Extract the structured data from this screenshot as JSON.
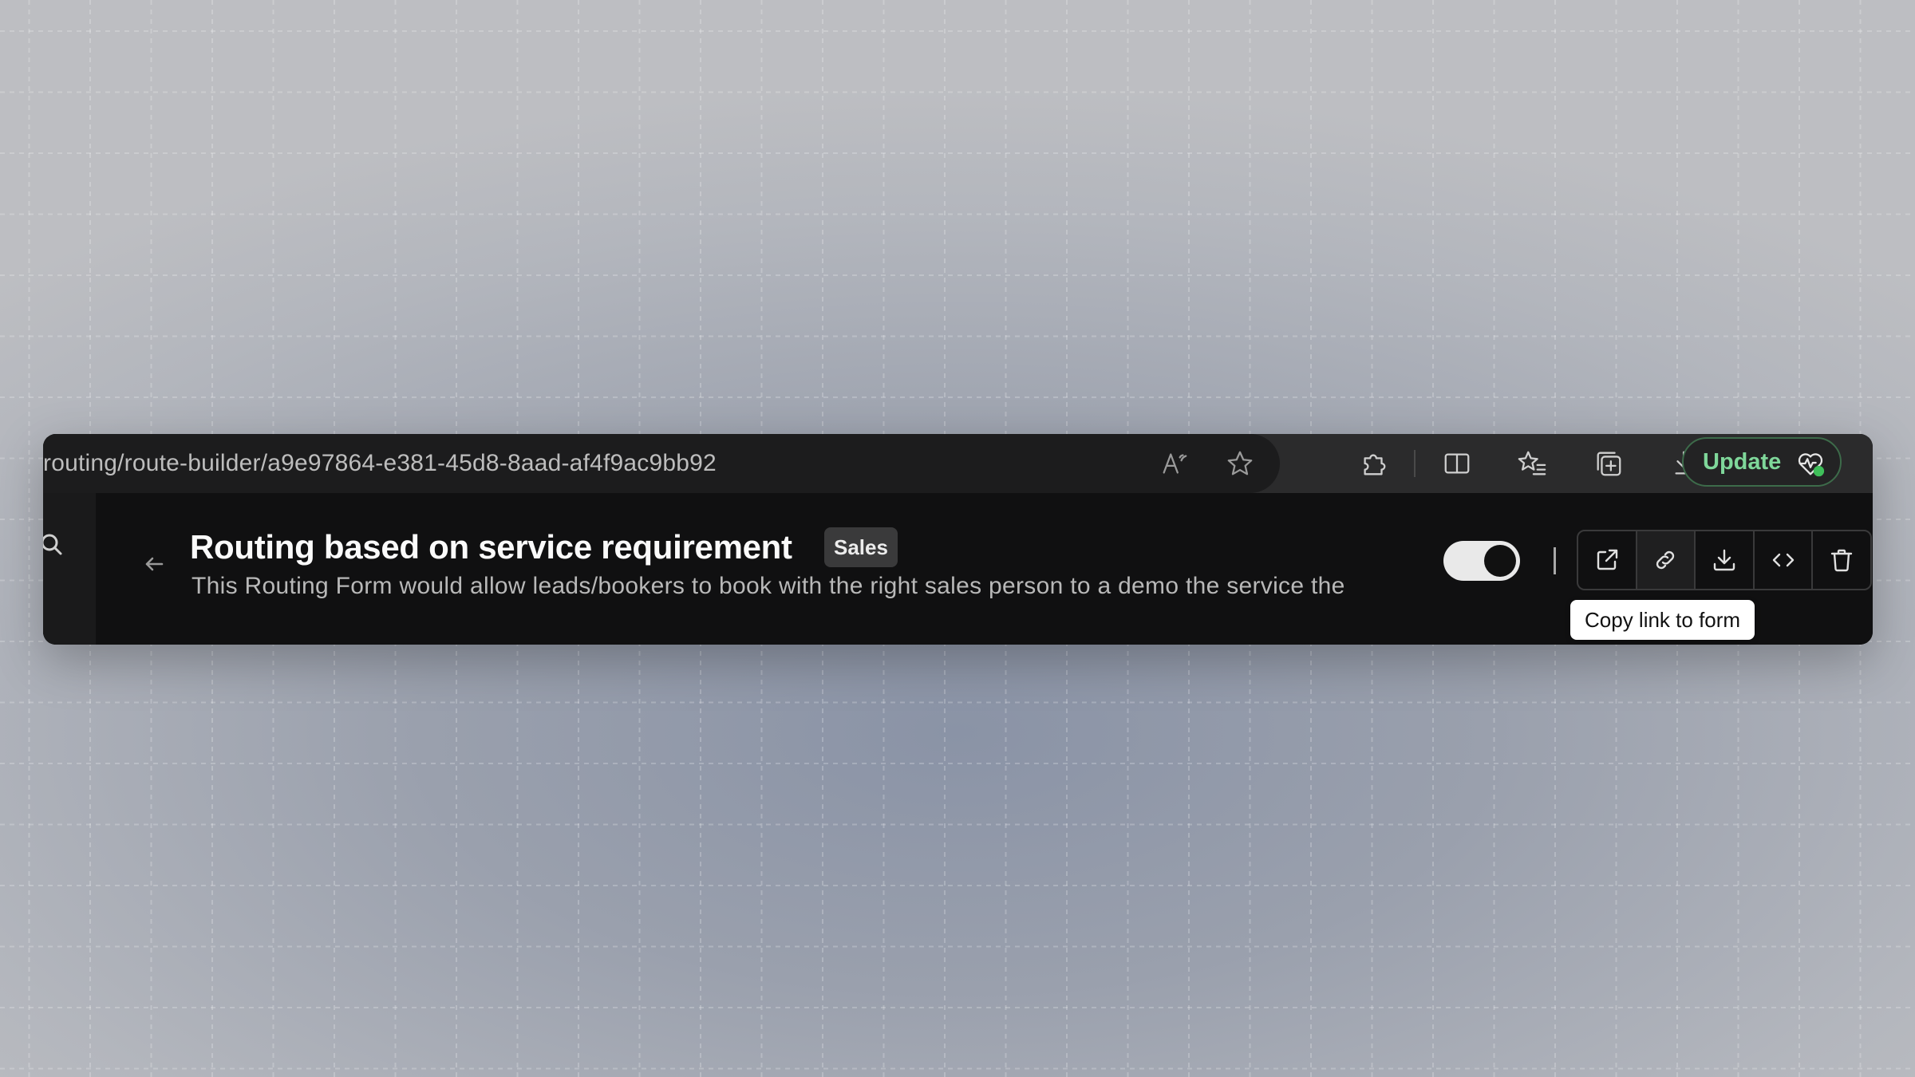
{
  "browser": {
    "url": "routing/route-builder/a9e97864-e381-45d8-8aad-af4f9ac9bb92",
    "update_label": "Update",
    "icons": [
      "read-aloud-icon",
      "star-icon",
      "extensions-icon",
      "split-screen-icon",
      "favorites-icon",
      "collections-icon",
      "downloads-icon",
      "heart-pulse-icon"
    ]
  },
  "form_header": {
    "title": "Routing based on service requirement",
    "badge": "Sales",
    "description": "This Routing Form would allow leads/bookers to book with the right sales person to a demo the service the",
    "toggle_on": true
  },
  "actions": {
    "buttons": [
      "external-link-icon",
      "link-icon",
      "download-icon",
      "code-icon",
      "trash-icon"
    ],
    "tooltip": "Copy link to form"
  },
  "colors": {
    "accent_green": "#7fd79a",
    "window_bg": "#101011"
  }
}
